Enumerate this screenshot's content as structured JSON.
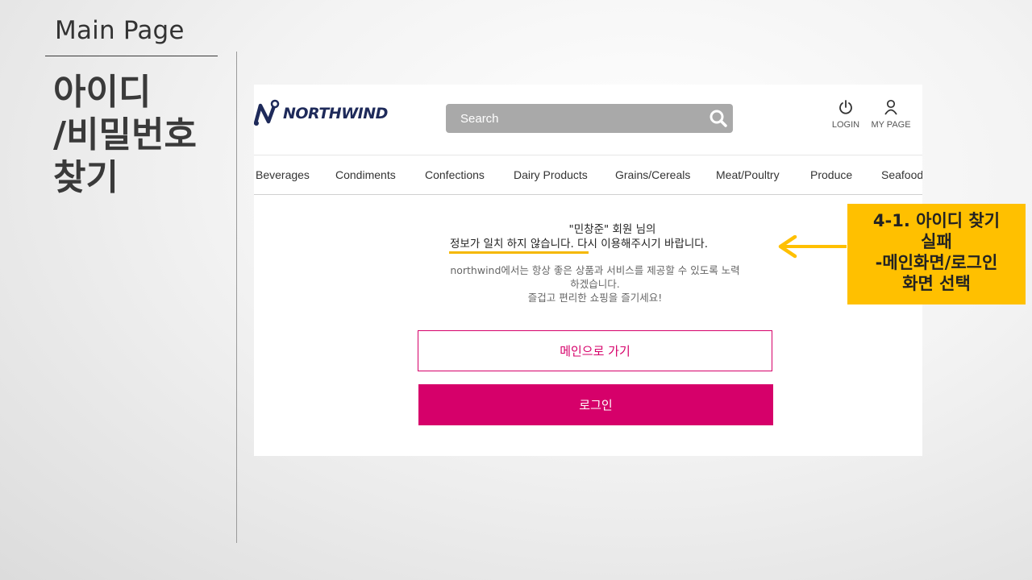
{
  "slide": {
    "subtitle": "Main Page",
    "title_lines": [
      "아이디",
      "/비밀번호",
      "찾기"
    ]
  },
  "site": {
    "logo_text": "NORTHWIND",
    "search": {
      "placeholder": "Search",
      "icon": "search-icon"
    },
    "header_icons": [
      {
        "icon": "power-icon",
        "label": "LOGIN"
      },
      {
        "icon": "user-icon",
        "label": "MY PAGE"
      }
    ],
    "nav": [
      "Beverages",
      "Condiments",
      "Confections",
      "Dairy Products",
      "Grains/Cereals",
      "Meat/Poultry",
      "Produce",
      "Seafood"
    ],
    "message": {
      "line1": "\"민창준\" 회원 님의",
      "line2": "정보가 일치 하지 않습니다. 다시 이용해주시기 바랍니다.",
      "desc_lines": [
        "northwind에서는 항상 좋은 상품과 서비스를 제공할 수 있도록 노력",
        "하겠습니다.",
        "즐겁고 편리한 쇼핑을 즐기세요!"
      ]
    },
    "buttons": {
      "main": "메인으로 가기",
      "login": "로그인"
    }
  },
  "callout": {
    "lines": [
      "4-1. 아이디 찾기",
      "실패",
      "-메인화면/로그인",
      "화면 선택"
    ]
  },
  "colors": {
    "accent_pink": "#d6006a",
    "callout_yellow": "#ffc000",
    "highlight_underline": "#f5b800",
    "search_bg": "#a9a9a9"
  }
}
